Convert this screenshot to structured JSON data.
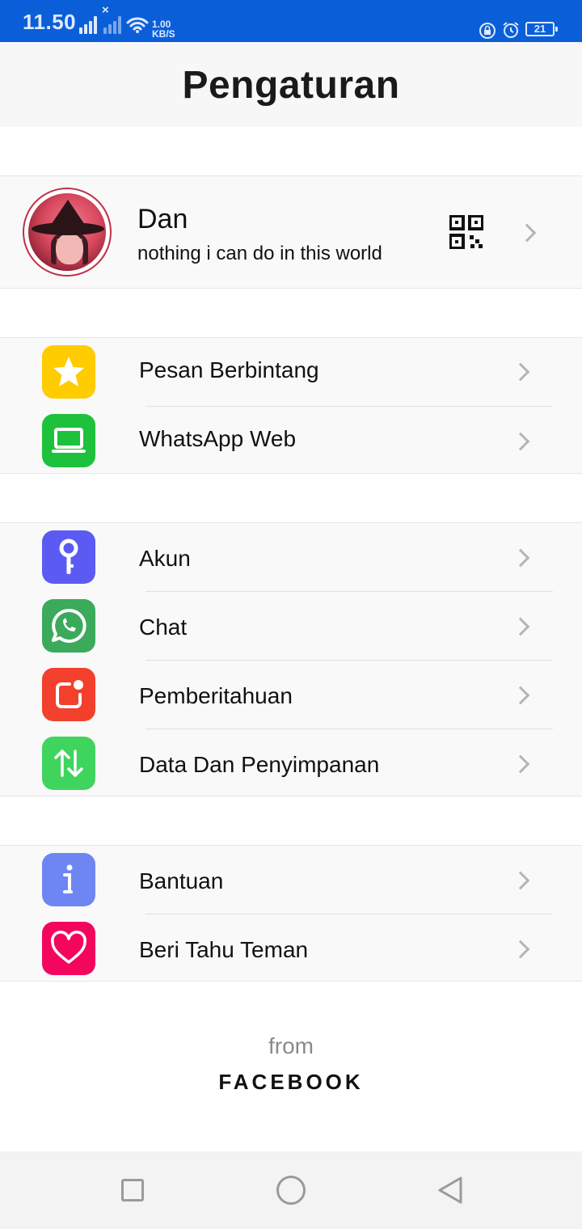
{
  "status_bar": {
    "time": "11.50",
    "network_speed_value": "1.00",
    "network_speed_unit": "KB/S",
    "battery": "21",
    "icons": [
      "signal-icon",
      "signal-no-service-icon",
      "wifi-icon",
      "lock-rotation-icon",
      "alarm-icon",
      "battery-icon"
    ]
  },
  "header": {
    "title": "Pengaturan"
  },
  "profile": {
    "name": "Dan",
    "status": "nothing i can do in this world",
    "qr_icon": "qr-code-icon"
  },
  "menu_groups": [
    [
      {
        "label": "Pesan Berbintang",
        "icon": "star-icon",
        "color": "#FFCC00"
      },
      {
        "label": "WhatsApp Web",
        "icon": "laptop-icon",
        "color": "#1DC13B"
      }
    ],
    [
      {
        "label": "Akun",
        "icon": "key-icon",
        "color": "#5B5BF4"
      },
      {
        "label": "Chat",
        "icon": "whatsapp-icon",
        "color": "#3BAA5B"
      },
      {
        "label": "Pemberitahuan",
        "icon": "notification-icon",
        "color": "#F2402C"
      },
      {
        "label": "Data Dan Penyimpanan",
        "icon": "data-transfer-icon",
        "color": "#3FD45E"
      }
    ],
    [
      {
        "label": "Bantuan",
        "icon": "info-icon",
        "color": "#6E86F2"
      },
      {
        "label": "Beri Tahu Teman",
        "icon": "heart-icon",
        "color": "#F4065E"
      }
    ]
  ],
  "footer": {
    "from": "from",
    "brand": "FACEBOOK"
  },
  "nav_bar": {
    "icons": [
      "recent-apps-icon",
      "home-icon",
      "back-icon"
    ]
  }
}
